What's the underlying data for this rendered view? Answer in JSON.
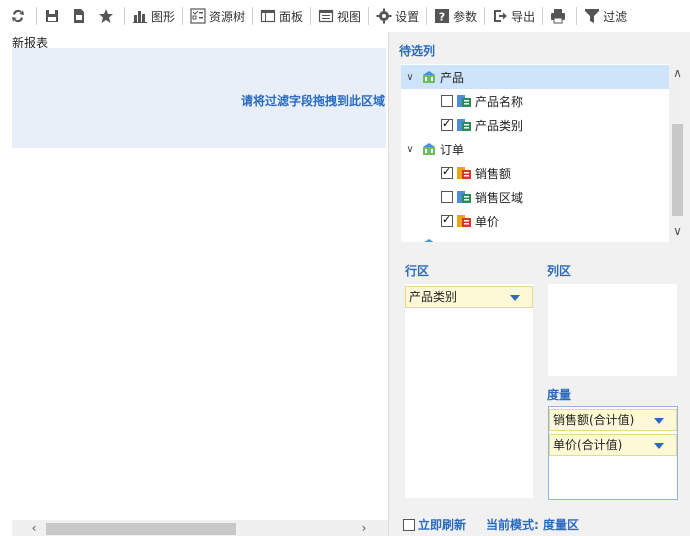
{
  "toolbar": {
    "chart_label": "图形",
    "resource_tree_label": "资源树",
    "panel_label": "面板",
    "view_label": "视图",
    "settings_label": "设置",
    "params_label": "参数",
    "export_label": "导出",
    "filter_label": "过滤"
  },
  "report": {
    "title": "新报表",
    "drop_hint": "请将过滤字段拖拽到此区域"
  },
  "candidates": {
    "title": "待选列",
    "tree": [
      {
        "label": "产品",
        "type": "group",
        "expanded": true,
        "selected": true
      },
      {
        "label": "产品名称",
        "type": "field",
        "checked": false,
        "icon": "green"
      },
      {
        "label": "产品类别",
        "type": "field",
        "checked": true,
        "icon": "green"
      },
      {
        "label": "订单",
        "type": "group",
        "expanded": true,
        "selected": false
      },
      {
        "label": "销售额",
        "type": "field",
        "checked": true,
        "icon": "red"
      },
      {
        "label": "销售区域",
        "type": "field",
        "checked": false,
        "icon": "green"
      },
      {
        "label": "单价",
        "type": "field",
        "checked": true,
        "icon": "red"
      }
    ]
  },
  "rows": {
    "title": "行区",
    "fields": [
      "产品类别"
    ]
  },
  "columns": {
    "title": "列区"
  },
  "measures": {
    "title": "度量",
    "fields": [
      "销售额(合计值)",
      "单价(合计值)"
    ]
  },
  "footer": {
    "auto_refresh_label": "立即刷新",
    "auto_refresh_checked": false,
    "mode_label": "当前模式: 度量区"
  },
  "colors": {
    "accent": "#2a6bbf",
    "field_bg": "#fdf8d6",
    "selection": "#cde4fb"
  }
}
